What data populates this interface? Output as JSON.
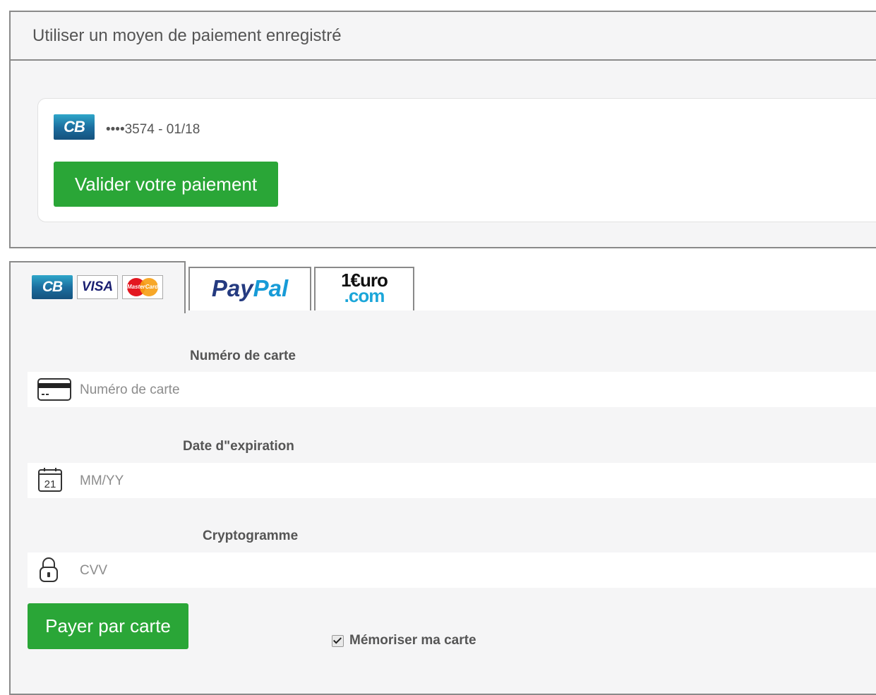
{
  "saved": {
    "header_title": "Utiliser un moyen de paiement enregistré",
    "card_brand_label": "CB",
    "card_info": "••••3574 - 01/18",
    "validate_label": "Valider votre paiement"
  },
  "tabs": {
    "cards": {
      "cb_label": "CB",
      "visa_label": "VISA",
      "mastercard_label": "MasterCard"
    },
    "paypal": {
      "part1": "Pay",
      "part2": "Pal"
    },
    "oneeuro": {
      "line1": "1€uro",
      "line2": ".com"
    }
  },
  "form": {
    "card_number": {
      "label": "Numéro de carte",
      "placeholder": "Numéro de carte",
      "icon": "credit-card-icon"
    },
    "expiry": {
      "label": "Date d\"expiration",
      "placeholder": "MM/YY",
      "icon": "calendar-icon",
      "icon_text": "21"
    },
    "cvv": {
      "label": "Cryptogramme",
      "placeholder": "CVV",
      "icon": "lock-icon"
    },
    "pay_label": "Payer par carte",
    "remember_label": "Mémoriser ma carte",
    "remember_checked": true
  },
  "colors": {
    "accent_green": "#2aa637",
    "panel_bg": "#f5f5f6",
    "border": "#8a8a8a",
    "paypal_dark": "#253b80",
    "paypal_light": "#179bd7"
  }
}
